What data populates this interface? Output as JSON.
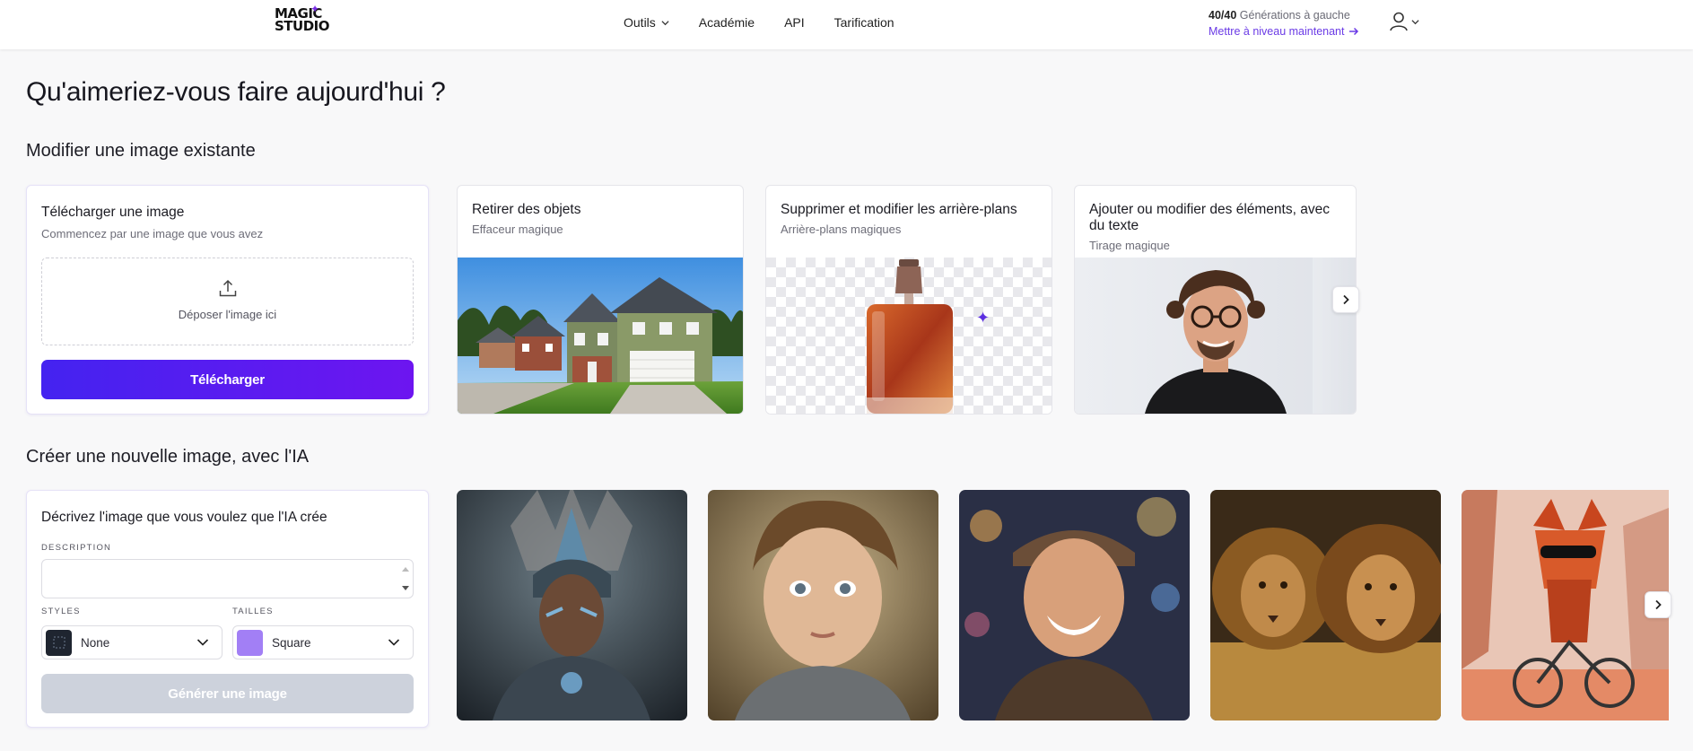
{
  "header": {
    "logo_line1": "MAGIC",
    "logo_line2": "STUDIO",
    "nav": [
      {
        "label": "Outils",
        "has_dropdown": true
      },
      {
        "label": "Académie"
      },
      {
        "label": "API"
      },
      {
        "label": "Tarification"
      }
    ],
    "generations_count": "40/40",
    "generations_label": "Générations à gauche",
    "upgrade_link": "Mettre à niveau maintenant"
  },
  "page_title": "Qu'aimeriez-vous faire aujourd'hui ?",
  "edit_section": {
    "heading": "Modifier une image existante",
    "upload_card": {
      "title": "Télécharger une image",
      "subtitle": "Commencez par une image que vous avez",
      "dropzone_text": "Déposer l'image ici",
      "button_label": "Télécharger"
    },
    "tools": [
      {
        "title": "Retirer des objets",
        "subtitle": "Effaceur magique",
        "image": "suburban-houses"
      },
      {
        "title": "Supprimer et modifier les arrière-plans",
        "subtitle": "Arrière-plans magiques",
        "image": "perfume-bottle-transparent"
      },
      {
        "title": "Ajouter ou modifier des éléments, avec du texte",
        "subtitle": "Tirage magique",
        "image": "smiling-man-glasses"
      }
    ]
  },
  "create_section": {
    "heading": "Créer une nouvelle image, avec l'IA",
    "card": {
      "title": "Décrivez l'image que vous voulez que l'IA crée",
      "description_label": "DESCRIPTION",
      "description_value": "",
      "styles_label": "STYLES",
      "styles_value": "None",
      "sizes_label": "TAILLES",
      "sizes_value": "Square",
      "generate_button": "Générer une image"
    },
    "gallery": [
      "warrior-portrait",
      "child-portrait",
      "smiling-man-cap",
      "two-lions",
      "red-panda-bicycle"
    ]
  },
  "colors": {
    "accent": "#6b3be6",
    "button_gradient_start": "#4423f0",
    "button_gradient_end": "#6d15f0",
    "disabled_button": "#cdd2dc",
    "size_swatch": "#a27ff5"
  }
}
